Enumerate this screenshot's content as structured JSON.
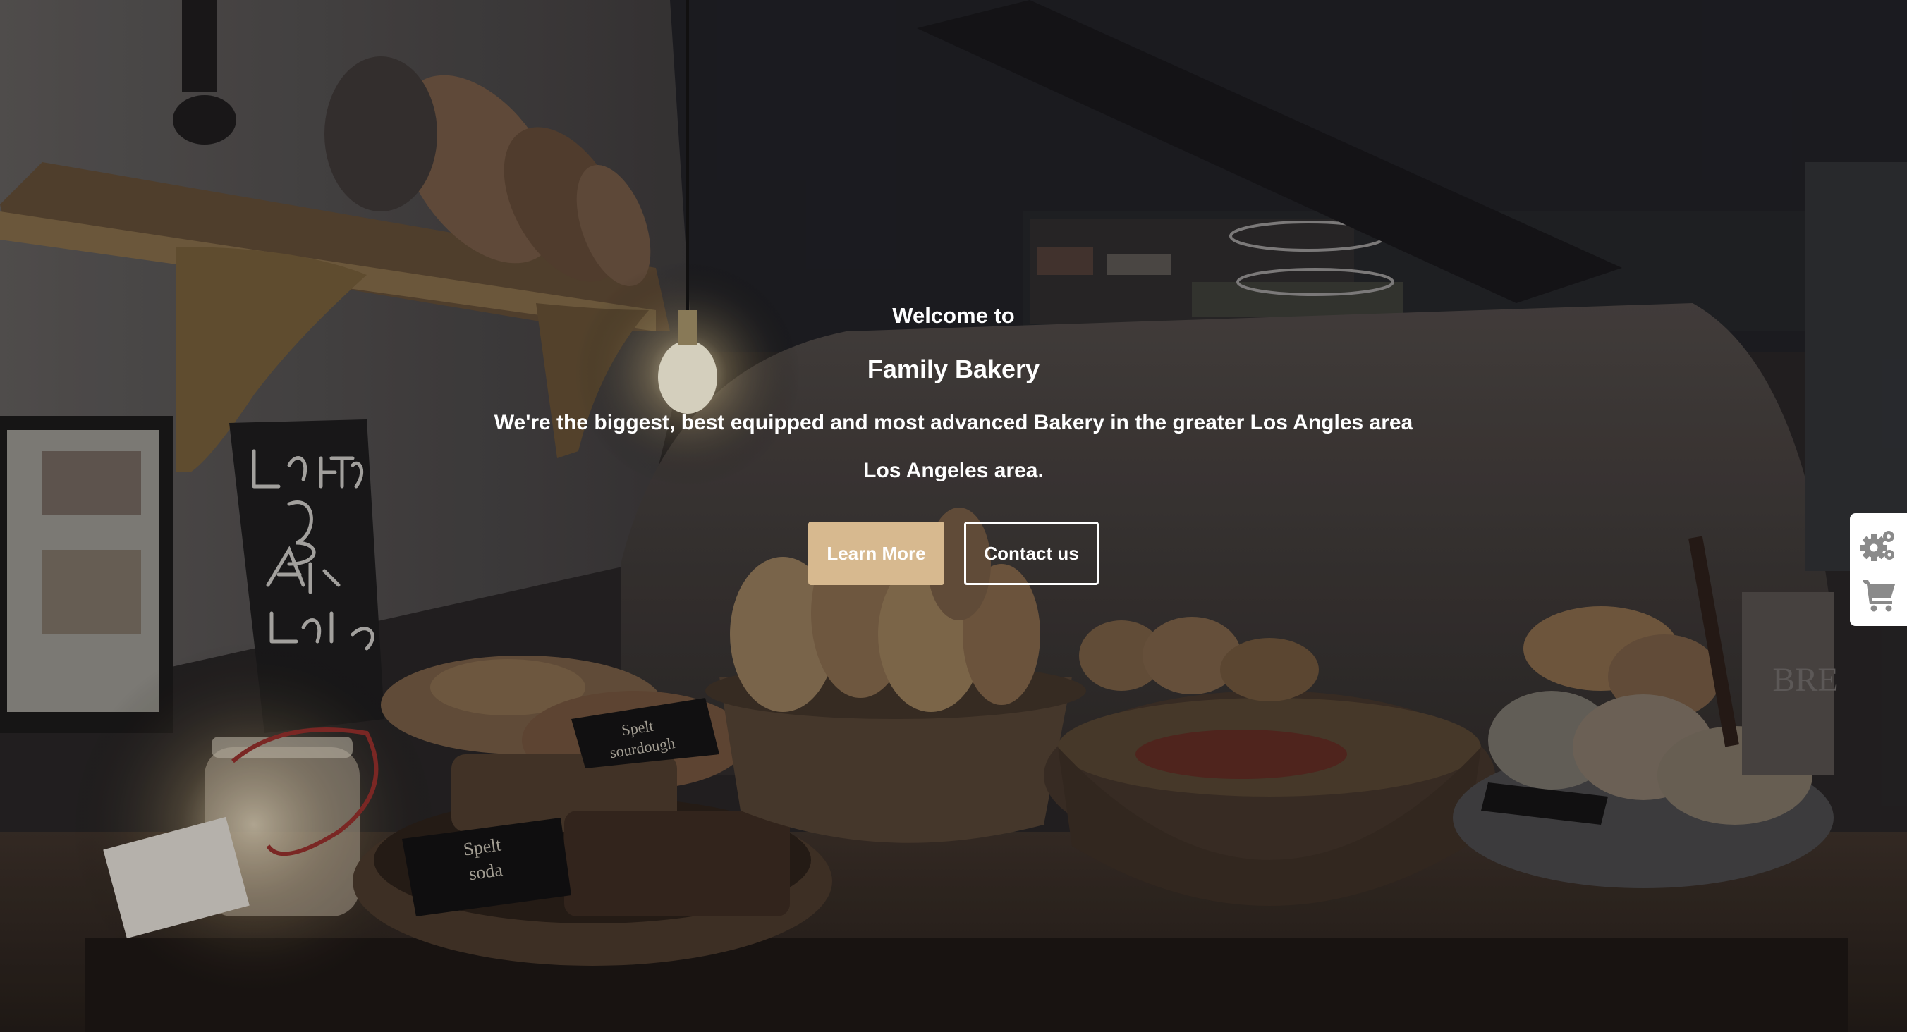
{
  "hero": {
    "welcome": "Welcome to",
    "title": "Family Bakery",
    "tagline": "We're the biggest, best equipped and most advanced Bakery in the greater Los Angles area",
    "area": "Los Angeles area.",
    "buttons": {
      "learn_more": "Learn More",
      "contact_us": "Contact us"
    },
    "background": {
      "chalkboard_lines": [
        "LoaF Too",
        "Big",
        "Any 1/2",
        "LoaF €2"
      ],
      "labels": [
        "Spelt sourdough",
        "Spelt soda",
        "BRE"
      ]
    }
  },
  "side_widget": {
    "icons": [
      "gears-icon",
      "cart-icon"
    ]
  },
  "colors": {
    "primary_button": "#d7b98f",
    "text": "#ffffff",
    "widget_bg": "#ffffff",
    "widget_icon": "#8a8a8a"
  }
}
